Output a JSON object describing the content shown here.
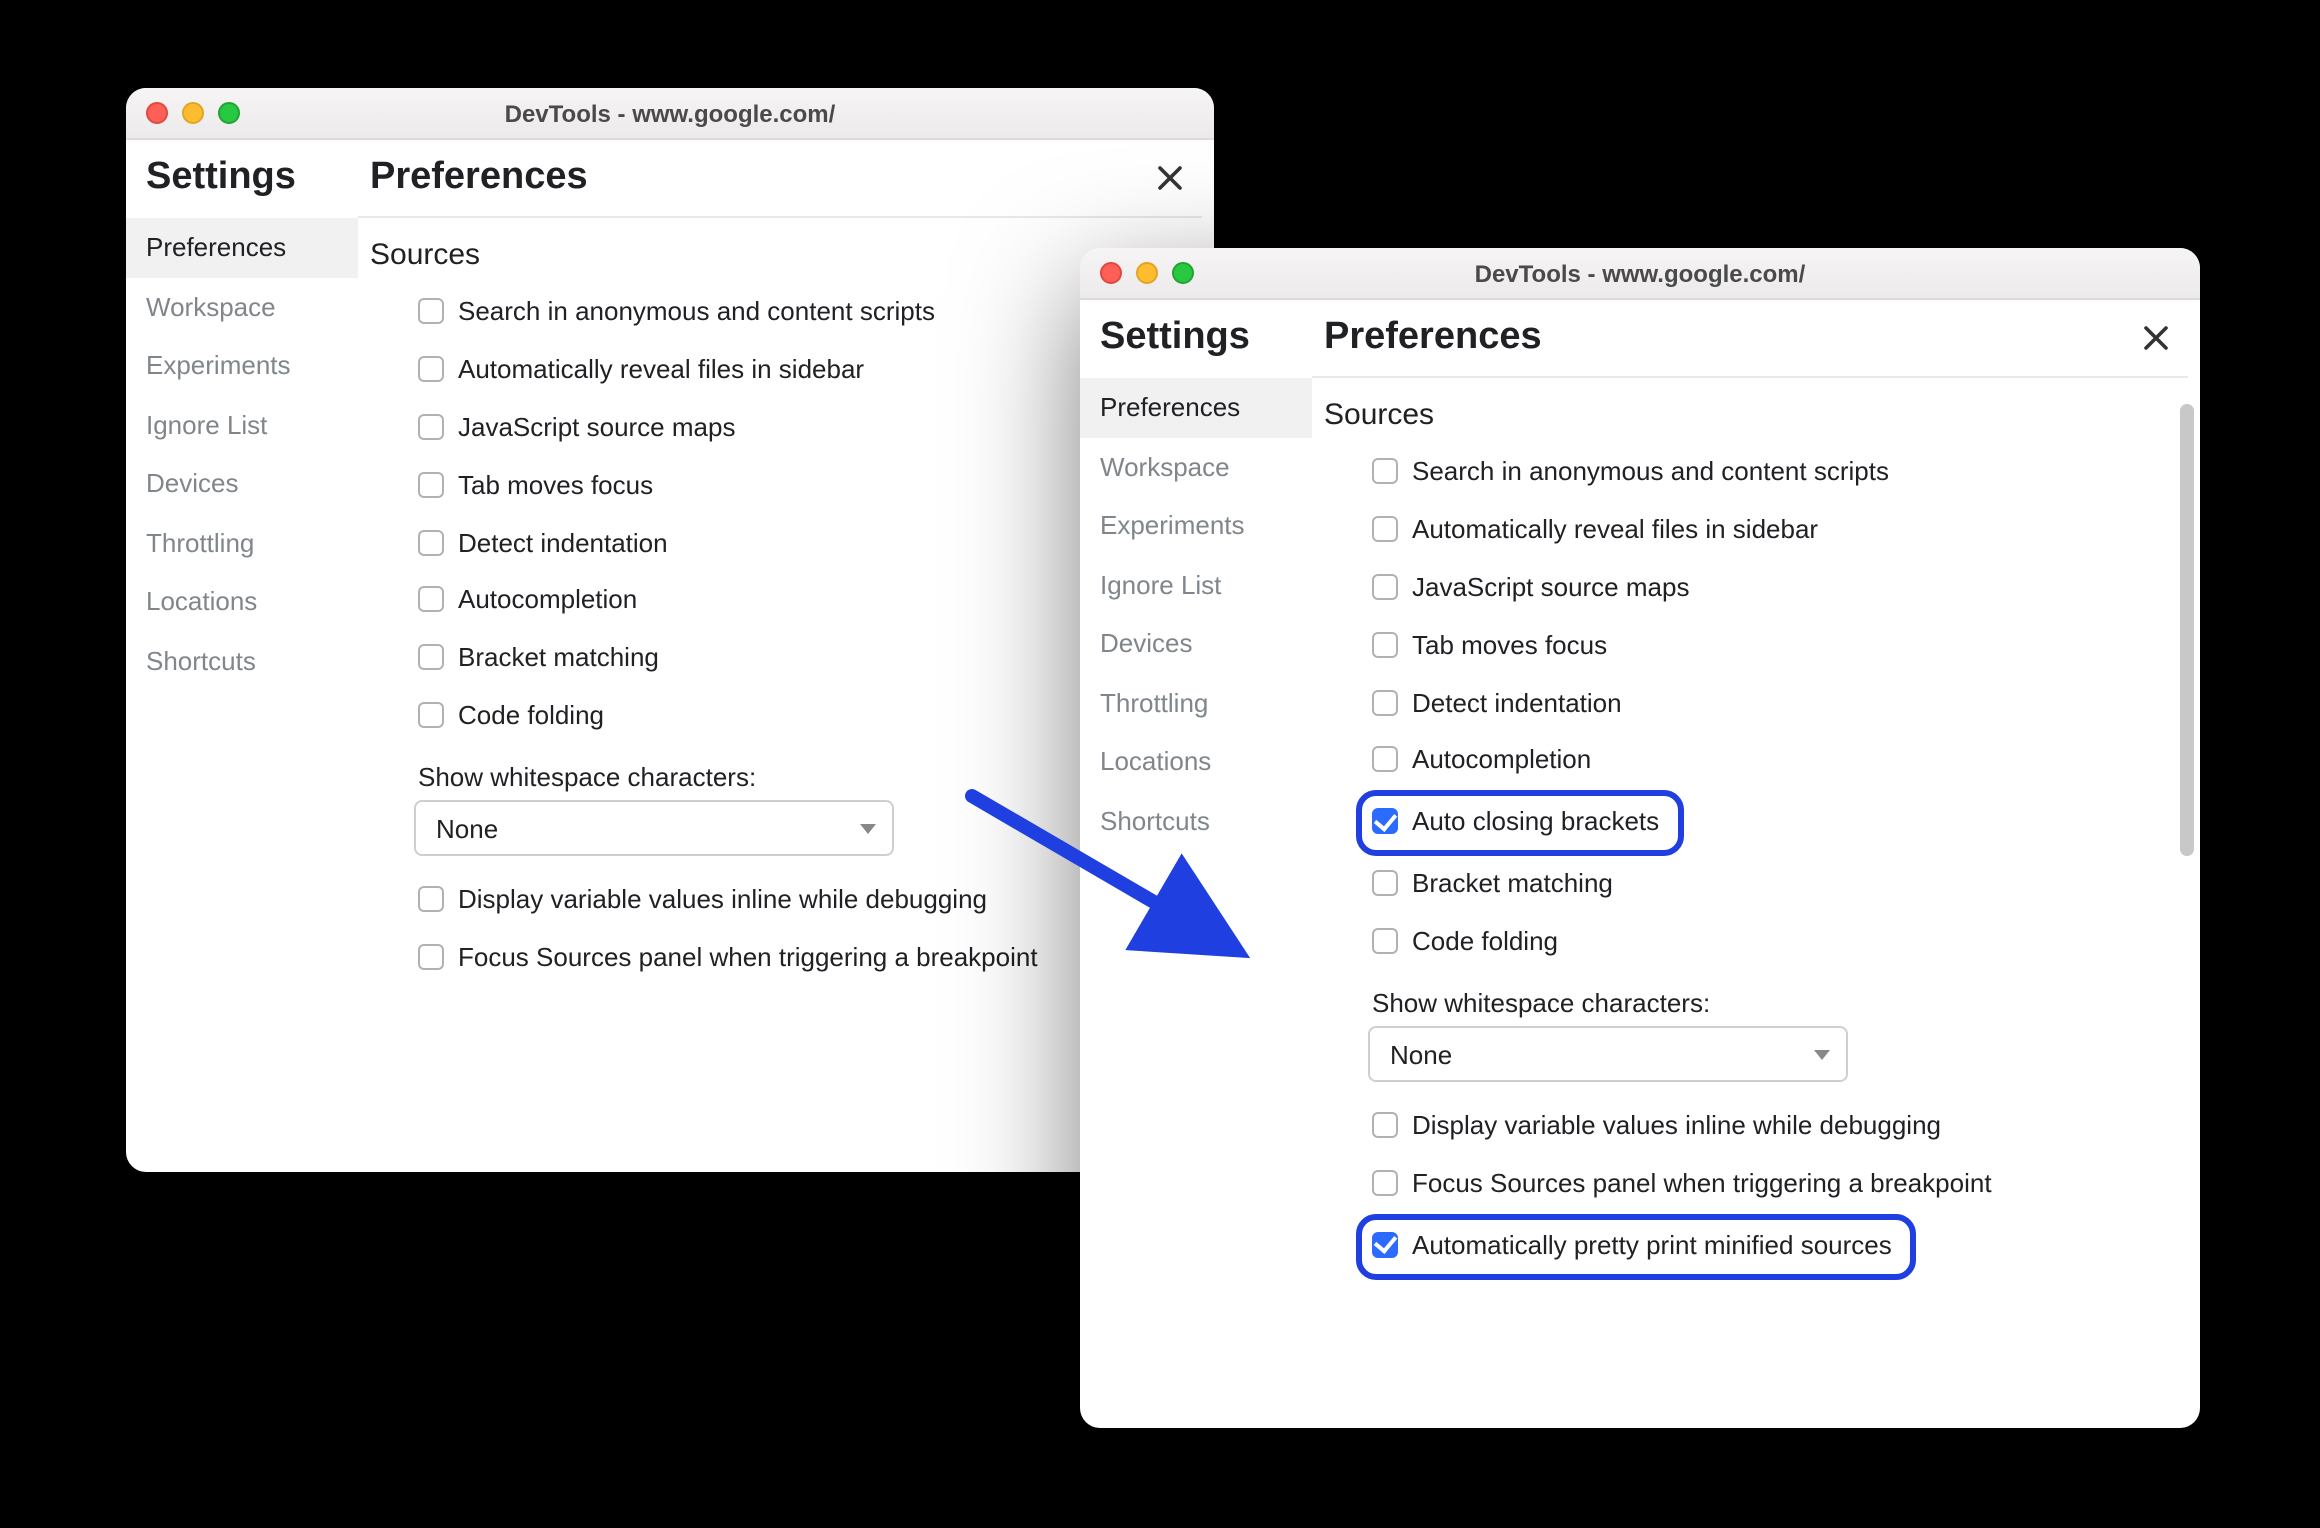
{
  "colors": {
    "accent": "#1f3fe0",
    "checkbox_checked": "#2b6bff"
  },
  "annotation": {
    "type": "arrow",
    "color": "#1f3fe0"
  },
  "left_window": {
    "title": "DevTools - www.google.com/",
    "settings_heading": "Settings",
    "preferences_heading": "Preferences",
    "nav": [
      {
        "label": "Preferences",
        "active": true
      },
      {
        "label": "Workspace",
        "active": false
      },
      {
        "label": "Experiments",
        "active": false
      },
      {
        "label": "Ignore List",
        "active": false
      },
      {
        "label": "Devices",
        "active": false
      },
      {
        "label": "Throttling",
        "active": false
      },
      {
        "label": "Locations",
        "active": false
      },
      {
        "label": "Shortcuts",
        "active": false
      }
    ],
    "section_title": "Sources",
    "options": [
      {
        "label": "Search in anonymous and content scripts",
        "checked": false
      },
      {
        "label": "Automatically reveal files in sidebar",
        "checked": false
      },
      {
        "label": "JavaScript source maps",
        "checked": false
      },
      {
        "label": "Tab moves focus",
        "checked": false
      },
      {
        "label": "Detect indentation",
        "checked": false
      },
      {
        "label": "Autocompletion",
        "checked": false
      },
      {
        "label": "Bracket matching",
        "checked": false
      },
      {
        "label": "Code folding",
        "checked": false
      }
    ],
    "whitespace_label": "Show whitespace characters:",
    "whitespace_value": "None",
    "options_after": [
      {
        "label": "Display variable values inline while debugging",
        "checked": false
      },
      {
        "label": "Focus Sources panel when triggering a breakpoint",
        "checked": false
      }
    ]
  },
  "right_window": {
    "title": "DevTools - www.google.com/",
    "settings_heading": "Settings",
    "preferences_heading": "Preferences",
    "nav": [
      {
        "label": "Preferences",
        "active": true
      },
      {
        "label": "Workspace",
        "active": false
      },
      {
        "label": "Experiments",
        "active": false
      },
      {
        "label": "Ignore List",
        "active": false
      },
      {
        "label": "Devices",
        "active": false
      },
      {
        "label": "Throttling",
        "active": false
      },
      {
        "label": "Locations",
        "active": false
      },
      {
        "label": "Shortcuts",
        "active": false
      }
    ],
    "section_title": "Sources",
    "options": [
      {
        "label": "Search in anonymous and content scripts",
        "checked": false,
        "highlight": false
      },
      {
        "label": "Automatically reveal files in sidebar",
        "checked": false,
        "highlight": false
      },
      {
        "label": "JavaScript source maps",
        "checked": false,
        "highlight": false
      },
      {
        "label": "Tab moves focus",
        "checked": false,
        "highlight": false
      },
      {
        "label": "Detect indentation",
        "checked": false,
        "highlight": false
      },
      {
        "label": "Autocompletion",
        "checked": false,
        "highlight": false
      },
      {
        "label": "Auto closing brackets",
        "checked": true,
        "highlight": true
      },
      {
        "label": "Bracket matching",
        "checked": false,
        "highlight": false
      },
      {
        "label": "Code folding",
        "checked": false,
        "highlight": false
      }
    ],
    "whitespace_label": "Show whitespace characters:",
    "whitespace_value": "None",
    "options_after": [
      {
        "label": "Display variable values inline while debugging",
        "checked": false,
        "highlight": false
      },
      {
        "label": "Focus Sources panel when triggering a breakpoint",
        "checked": false,
        "highlight": false
      },
      {
        "label": "Automatically pretty print minified sources",
        "checked": true,
        "highlight": true
      }
    ]
  }
}
